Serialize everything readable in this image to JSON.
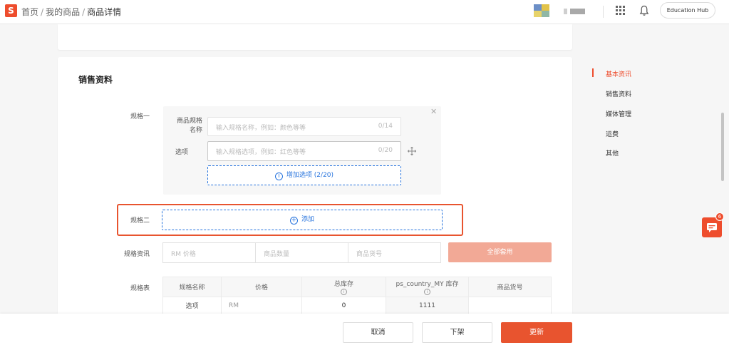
{
  "header": {
    "logo_text": "S",
    "breadcrumb": {
      "home": "首页",
      "sep": "/",
      "products": "我的商品",
      "current": "商品详情"
    },
    "education_hub": "Education Hub"
  },
  "section": {
    "title": "销售资料"
  },
  "variation1": {
    "label": "规格一",
    "name_label": "商品规格名称",
    "name_placeholder": "输入规格名称，例如：颜色等等",
    "name_count": "0/14",
    "option_label": "选项",
    "option_placeholder": "输入规格选项，例如：红色等等",
    "option_count": "0/20",
    "add_option": "增加选项 (2/20)"
  },
  "variation2": {
    "label": "规格二",
    "add_label": "添加"
  },
  "spec_info": {
    "label": "规格资讯",
    "price_placeholder": "RM 价格",
    "stock_placeholder": "商品数量",
    "sku_placeholder": "商品货号",
    "apply_all": "全部套用"
  },
  "spec_table": {
    "label": "规格表",
    "headers": [
      "规格名称",
      "价格",
      "总库存",
      "ps_country_MY 库存",
      "商品货号"
    ],
    "row": [
      "选项",
      "RM",
      "0",
      "1111",
      ""
    ]
  },
  "side_nav": {
    "items": [
      "基本资讯",
      "销售资料",
      "媒体管理",
      "运费",
      "其他"
    ],
    "active_index": 0
  },
  "chat": {
    "badge": "6"
  },
  "footer": {
    "cancel": "取消",
    "delist": "下架",
    "update": "更新"
  },
  "colors": {
    "brand": "#ee4d2d",
    "link": "#2673dd",
    "disabled": "#f2a996"
  },
  "icons": [
    "shopee-logo-icon",
    "apps-grid-icon",
    "bell-icon",
    "close-icon",
    "move-handle-icon",
    "plus-circle-icon",
    "info-icon",
    "chat-icon"
  ]
}
